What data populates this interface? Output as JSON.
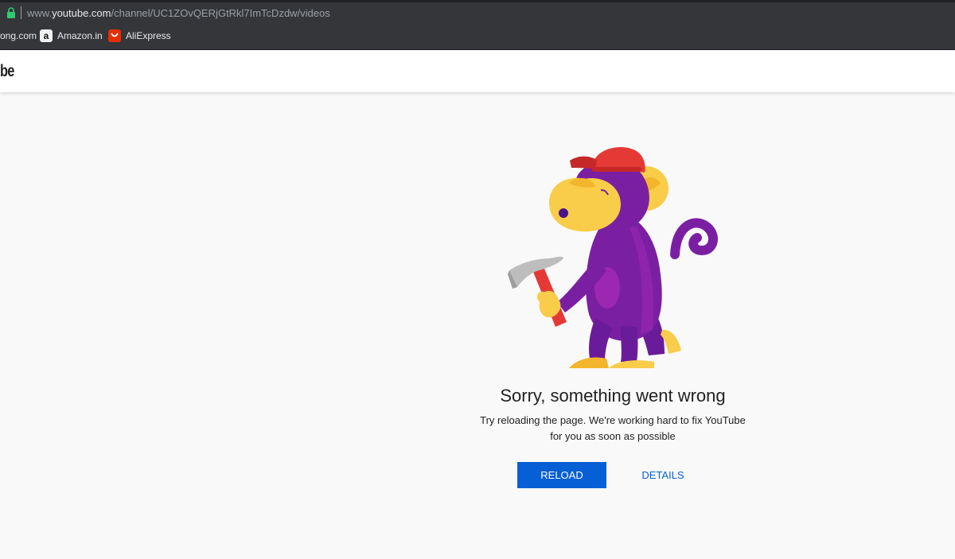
{
  "browser": {
    "url_prefix": "www.",
    "url_host": "youtube.com",
    "url_path": "/channel/UC1ZOvQERjGtRkl7ImTcDzdw/videos",
    "bookmarks": [
      {
        "label": "ong.com",
        "icon": "site-icon"
      },
      {
        "label": "Amazon.in",
        "icon": "amazon-icon"
      },
      {
        "label": "AliExpress",
        "icon": "aliexpress-icon"
      }
    ]
  },
  "header": {
    "logo_text": "be"
  },
  "error": {
    "title": "Sorry, something went wrong",
    "message_line1": "Try reloading the page. We're working hard to fix YouTube",
    "message_line2": "for you as soon as possible",
    "reload_label": "RELOAD",
    "details_label": "DETAILS"
  },
  "colors": {
    "accent": "#065fd4",
    "monkey_purple": "#7b1fa2",
    "monkey_face": "#f9cc4a",
    "hat_red": "#e53935"
  }
}
